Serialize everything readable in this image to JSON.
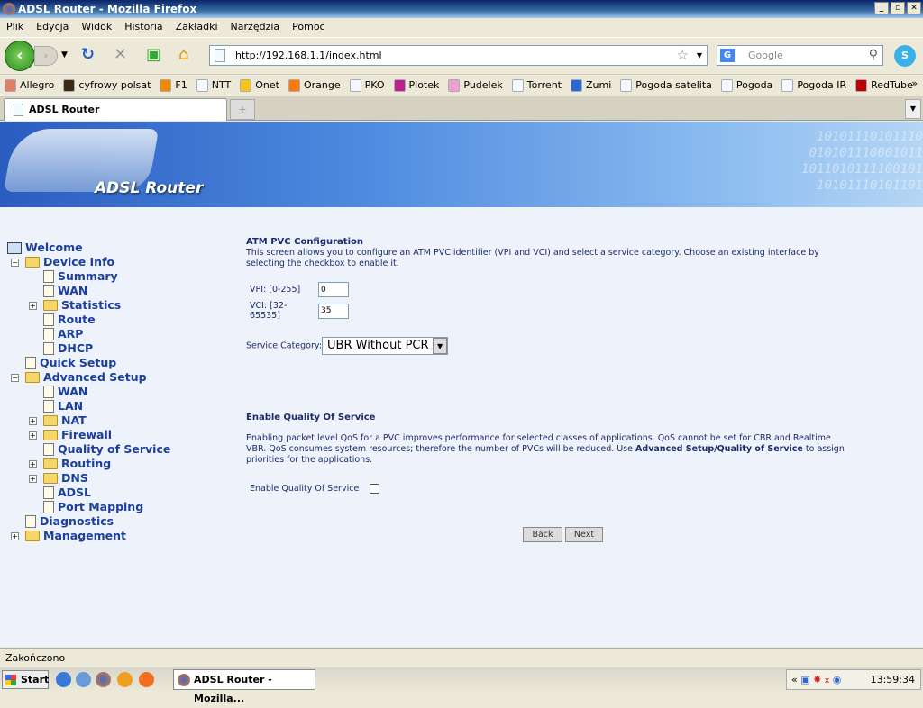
{
  "window": {
    "title": "ADSL Router - Mozilla Firefox",
    "controls": [
      "_",
      "▫",
      "✕"
    ]
  },
  "menu": [
    "Plik",
    "Edycja",
    "Widok",
    "Historia",
    "Zakładki",
    "Narzędzia",
    "Pomoc"
  ],
  "nav": {
    "url": "http://192.168.1.1/index.html",
    "search_placeholder": "Google"
  },
  "bookmarks": [
    {
      "label": "Allegro",
      "color": "#e08060"
    },
    {
      "label": "cyfrowy polsat",
      "color": "#3a2a10"
    },
    {
      "label": "F1",
      "color": "#f08a00"
    },
    {
      "label": "NTT",
      "color": "#f4f8ff"
    },
    {
      "label": "Onet",
      "color": "#f5c518"
    },
    {
      "label": "Orange",
      "color": "#ff7900"
    },
    {
      "label": "PKO",
      "color": "#f4f8ff"
    },
    {
      "label": "Plotek",
      "color": "#c0208a"
    },
    {
      "label": "Pudelek",
      "color": "#f0a0d0"
    },
    {
      "label": "Torrent",
      "color": "#f4f8ff"
    },
    {
      "label": "Zumi",
      "color": "#2a6ad0"
    },
    {
      "label": "Pogoda satelita",
      "color": "#f4f8ff"
    },
    {
      "label": "Pogoda",
      "color": "#f4f8ff"
    },
    {
      "label": "Pogoda IR",
      "color": "#f4f8ff"
    },
    {
      "label": "RedTube",
      "color": "#c00000"
    }
  ],
  "bookmarks_more": "»",
  "tab": {
    "title": "ADSL Router",
    "new": "+"
  },
  "banner": {
    "logo": "ADSL Router",
    "binary": "10101110101110\n010101110001011\n1011010111100101\n10101110101101"
  },
  "tree": [
    {
      "label": "Welcome",
      "type": "pc",
      "level": 0
    },
    {
      "label": "Device Info",
      "type": "folder-open",
      "level": 0,
      "exp": "−"
    },
    {
      "label": "Summary",
      "type": "doc",
      "level": 1
    },
    {
      "label": "WAN",
      "type": "doc",
      "level": 1
    },
    {
      "label": "Statistics",
      "type": "folder",
      "level": 1,
      "exp": "+"
    },
    {
      "label": "Route",
      "type": "doc",
      "level": 1
    },
    {
      "label": "ARP",
      "type": "doc",
      "level": 1
    },
    {
      "label": "DHCP",
      "type": "doc",
      "level": 1
    },
    {
      "label": "Quick Setup",
      "type": "doc",
      "level": 0
    },
    {
      "label": "Advanced Setup",
      "type": "folder-open",
      "level": 0,
      "exp": "−"
    },
    {
      "label": "WAN",
      "type": "doc",
      "level": 1
    },
    {
      "label": "LAN",
      "type": "doc",
      "level": 1
    },
    {
      "label": "NAT",
      "type": "folder",
      "level": 1,
      "exp": "+"
    },
    {
      "label": "Firewall",
      "type": "folder",
      "level": 1,
      "exp": "+"
    },
    {
      "label": "Quality of Service",
      "type": "doc",
      "level": 1
    },
    {
      "label": "Routing",
      "type": "folder",
      "level": 1,
      "exp": "+"
    },
    {
      "label": "DNS",
      "type": "folder",
      "level": 1,
      "exp": "+"
    },
    {
      "label": "ADSL",
      "type": "doc",
      "level": 1
    },
    {
      "label": "Port Mapping",
      "type": "doc",
      "level": 1
    },
    {
      "label": "Diagnostics",
      "type": "doc",
      "level": 0
    },
    {
      "label": "Management",
      "type": "folder",
      "level": 0,
      "exp": "+"
    }
  ],
  "main": {
    "title": "ATM PVC Configuration",
    "desc": "This screen allows you to configure an ATM PVC identifier (VPI and VCI) and select a service category. Choose an existing interface by selecting the checkbox to enable it.",
    "vpi_label": "VPI: [0-255]",
    "vpi_value": "0",
    "vci_label": "VCI: [32-65535]",
    "vci_value": "35",
    "service_label": "Service Category:",
    "service_value": "UBR Without PCR",
    "qos_title": "Enable Quality Of Service",
    "qos_desc_1": "Enabling packet level QoS for a PVC improves performance for selected classes of applications.  QoS cannot be set for CBR and Realtime VBR.  QoS consumes system resources; therefore the number of PVCs will be reduced. Use ",
    "qos_desc_link": "Advanced Setup/Quality of Service",
    "qos_desc_2": " to assign priorities for the applications.",
    "qos_checkbox_label": "Enable Quality Of Service",
    "qos_checked": false,
    "back": "Back",
    "next": "Next"
  },
  "status": "Zakończono",
  "taskbar": {
    "start": "Start",
    "task": "ADSL Router - Mozilla...",
    "tray_arrow": "«",
    "clock": "13:59:34"
  }
}
